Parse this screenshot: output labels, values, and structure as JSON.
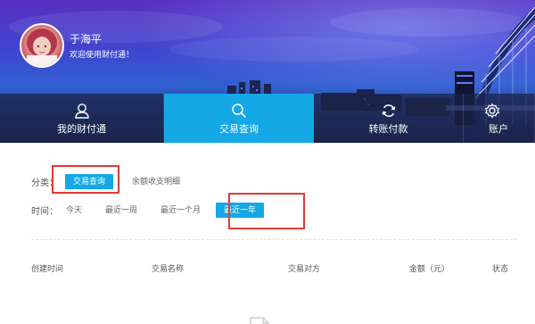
{
  "user": {
    "name": "于海平",
    "welcome": "欢迎使用财付通！"
  },
  "nav": [
    {
      "label": "我的财付通",
      "icon": "user-icon",
      "active": false
    },
    {
      "label": "交易查询",
      "icon": "search-icon",
      "active": true
    },
    {
      "label": "转账付款",
      "icon": "refresh-icon",
      "active": false
    },
    {
      "label": "账户",
      "icon": "gear-icon",
      "active": false
    }
  ],
  "filters": {
    "category_label": "分类：",
    "category_options": [
      "交易查询",
      "余额收支明细"
    ],
    "time_label": "时间：",
    "time_options": [
      "今天",
      "最近一周",
      "最近一个月",
      "最近一年"
    ]
  },
  "table": {
    "headers": [
      "创建时间",
      "交易名称",
      "交易对方",
      "金额（元）",
      "状态"
    ]
  },
  "colors": {
    "accent": "#14a8e6",
    "highlight": "#e53935"
  }
}
